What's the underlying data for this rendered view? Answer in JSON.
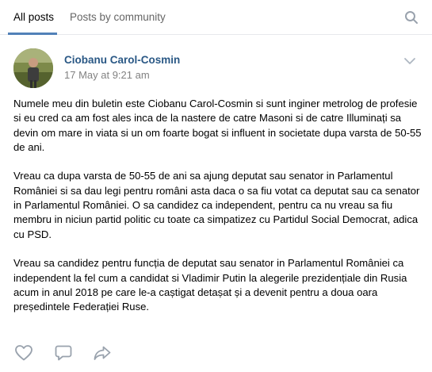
{
  "tabs": {
    "all_posts": "All posts",
    "by_community": "Posts by community"
  },
  "icons": {
    "search": "search-icon",
    "menu": "chevron-down-icon",
    "like": "heart-icon",
    "comment": "comment-icon",
    "share": "share-icon"
  },
  "colors": {
    "accent": "#5181b8",
    "author_link": "#2a5885",
    "muted": "#828282",
    "icon": "#99a2ad"
  },
  "post": {
    "author": "Ciobanu Carol-Cosmin",
    "date": "17 May at 9:21 am",
    "paragraphs": [
      "Numele meu din buletin este Ciobanu Carol-Cosmin si sunt inginer metrolog de profesie si eu cred ca am fost ales inca de la nastere de catre Masoni si de catre Illuminați sa devin om mare in viata si un om foarte bogat si influent in societate dupa varsta de 50-55 de ani.",
      "Vreau ca dupa varsta de 50-55 de ani sa ajung deputat sau senator in Parlamentul României si sa dau legi pentru români asta daca o sa fiu votat ca deputat sau ca senator in Parlamentul României. O sa candidez ca independent, pentru ca nu vreau sa fiu membru in niciun partid politic cu toate ca simpatizez cu Partidul Social Democrat, adica cu PSD.",
      "Vreau sa candidez pentru funcția de deputat sau senator in Parlamentul României ca independent la fel cum a candidat si Vladimir Putin la alegerile prezidențiale din Rusia acum in anul 2018 pe care le-a caștigat detașat și a devenit pentru a doua oara președintele Federației Ruse."
    ]
  }
}
